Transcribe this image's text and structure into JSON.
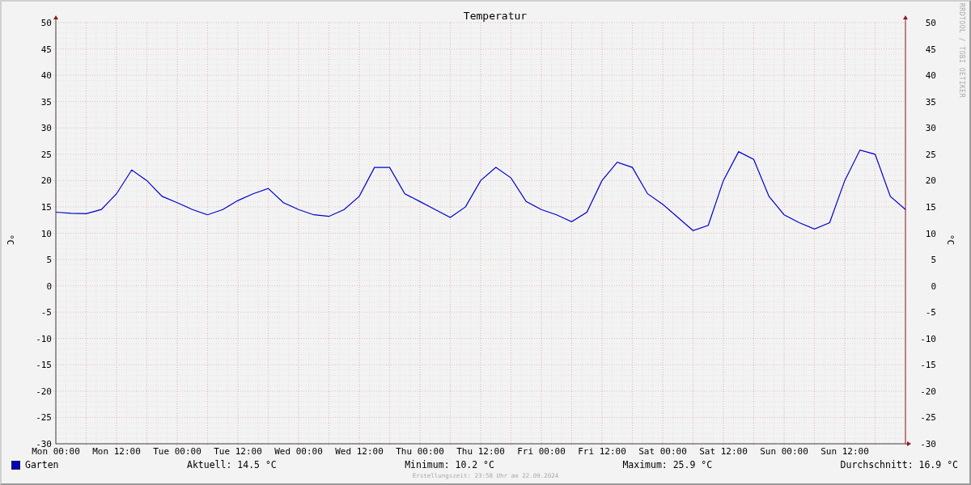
{
  "graph": {
    "credit": "RRDTOOL / TOBI OETIKER",
    "right_axis_label": "°C",
    "right_yticks": [
      "50",
      "45",
      "40",
      "35",
      "30",
      "25",
      "20",
      "15",
      "10",
      "5",
      "0",
      "-5",
      "-10",
      "-15",
      "-20",
      "-25",
      "-30"
    ],
    "chart_data": {
      "type": "line",
      "grid": true,
      "title": "Temperatur",
      "ylabel": "°C",
      "ylim": [
        -30,
        50
      ],
      "yticks": [
        -30,
        -25,
        -20,
        -15,
        -10,
        -5,
        0,
        5,
        10,
        15,
        20,
        25,
        30,
        35,
        40,
        45,
        50
      ],
      "categories": [
        "Mon 00:00",
        null,
        null,
        null,
        "Mon 12:00",
        null,
        null,
        null,
        "Tue 00:00",
        null,
        null,
        null,
        "Tue 12:00",
        null,
        null,
        null,
        "Wed 00:00",
        null,
        null,
        null,
        "Wed 12:00",
        null,
        null,
        null,
        "Thu 00:00",
        null,
        null,
        null,
        "Thu 12:00",
        null,
        null,
        null,
        "Fri 00:00",
        null,
        null,
        null,
        "Fri 12:00",
        null,
        null,
        null,
        "Sat 00:00",
        null,
        null,
        null,
        "Sat 12:00",
        null,
        null,
        null,
        "Sun 00:00",
        null,
        null,
        null,
        "Sun 12:00",
        null,
        null,
        null,
        null
      ],
      "series": [
        {
          "name": "Garten",
          "color": "#0000cc",
          "values": [
            14,
            13.8,
            13.7,
            14.5,
            17.5,
            22,
            20,
            17,
            15.8,
            14.5,
            13.5,
            14.5,
            16.2,
            17.5,
            18.5,
            15.8,
            14.5,
            13.5,
            13.2,
            14.5,
            17,
            22.5,
            22.5,
            17.5,
            16,
            14.5,
            13,
            15,
            20,
            22.5,
            20.5,
            16,
            14.5,
            13.5,
            12.2,
            14,
            20,
            23.5,
            22.5,
            17.5,
            15.5,
            13,
            10.5,
            11.5,
            20,
            25.5,
            24,
            17,
            13.5,
            12,
            10.8,
            12,
            20,
            25.8,
            25,
            17,
            14.5
          ]
        }
      ]
    }
  },
  "stats": [
    "Aktuell: 14.5 °C",
    "Minimum: 10.2 °C",
    "Maximum: 25.9 °C",
    "Durchschnitt: 16.9 °C"
  ],
  "footer": "Erstellungszeit: 23:58 Uhr am 22.09.2024"
}
